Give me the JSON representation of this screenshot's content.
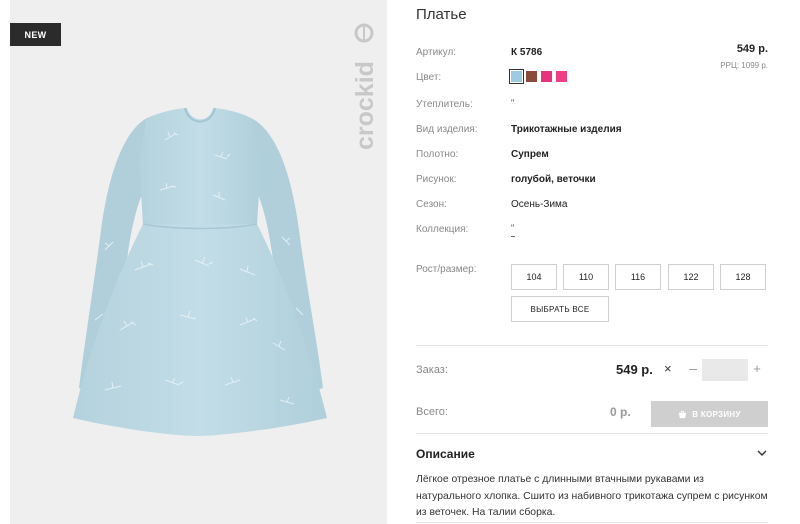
{
  "badge": "NEW",
  "brand": "crockid",
  "product": {
    "title": "Платье",
    "price": "549 р.",
    "rrp": "РРЦ: 1099 р."
  },
  "attributes": {
    "article": {
      "label": "Артикул:",
      "value": "К 5786"
    },
    "color": {
      "label": "Цвет:",
      "swatches": [
        "#9dcbe6",
        "#8b4a3c",
        "#e8337c",
        "#ee3e86"
      ]
    },
    "insulation": {
      "label": "Утеплитель:",
      "value": "\""
    },
    "product_type": {
      "label": "Вид изделия:",
      "value": "Трикотажные изделия"
    },
    "fabric": {
      "label": "Полотно:",
      "value": "Супрем"
    },
    "pattern": {
      "label": "Рисунок:",
      "value": "голубой, веточки"
    },
    "season": {
      "label": "Сезон:",
      "value": "Осень-Зима"
    },
    "collection": {
      "label": "Коллекция:",
      "value": "\""
    }
  },
  "sizes": {
    "label": "Рост/размер:",
    "options": [
      "104",
      "110",
      "116",
      "122",
      "128"
    ],
    "select_all": "ВЫБРАТЬ ВСЕ"
  },
  "order": {
    "label": "Заказ:",
    "price": "549 р.",
    "times": "×",
    "minus": "–",
    "plus": "+",
    "qty": ""
  },
  "total": {
    "label": "Всего:",
    "value": "0 р.",
    "cart_button": "В КОРЗИНУ"
  },
  "description": {
    "heading": "Описание",
    "text": "Лёгкое отрезное платье с длинными втачными рукавами из натурального хлопка. Сшито из набивного трикотажа супрем с рисунком из веточек. На талии сборка."
  }
}
